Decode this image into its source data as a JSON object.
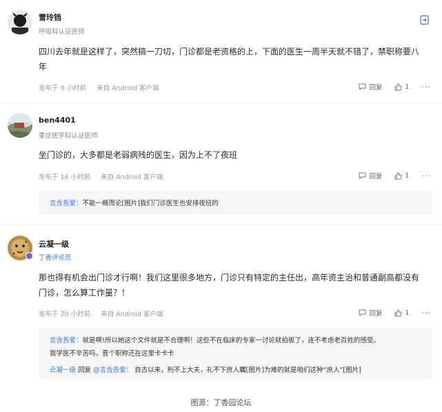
{
  "comments": [
    {
      "username": "雪玲铛",
      "role": "呼吸科认证医师",
      "content_line1": "四川去年就是这样了，突然搞一刀切，门诊都是老资格的上，下面的医生一周半天就不错了，禁职称要八",
      "content_line2": "年",
      "posted": "发布于 9 小时前",
      "source": "来自 Android 客户端",
      "reply_label": "回复",
      "likes": "1"
    },
    {
      "username": "ben4401",
      "role": "重症医学科认证医师",
      "content_line1": "坐门诊的，大多都是老弱病残的医生，因为上不了夜班",
      "posted": "发布于 16 小时前",
      "source": "来自 Android 客户端",
      "reply_label": "回复",
      "likes": "1",
      "replies": [
        {
          "author": "言含吾爱：",
          "text": "不能一概而论[图片]我们门诊医生也安排夜班的"
        }
      ]
    },
    {
      "username": "云凝一级",
      "role": "丁香评论员",
      "content_line1": "那也得有机会出门诊才行啊！我们这里很多地方，门诊只有特定的主任出，高年资主治和普通副高都没有",
      "content_line2": "门诊，怎么算工作量？！",
      "posted": "发布于 20 小时前",
      "source": "来自 Android 客户端",
      "reply_label": "回复",
      "likes": "1",
      "replies": [
        {
          "author": "言含吾爱：",
          "text": "就是啊!所以她这个文件就是不合理啊！这些不在临床的专家一讨论就拍板了，连不考虑老百姓的感受。",
          "text2": "我学医不辛苦吗，晋个职称还在这里卡卡卡"
        },
        {
          "author": "云凝一级",
          "mid": "回复",
          "target": "@言含吾爱：",
          "text": "自古以来，刑不上大夫，礼不下庶人瞩[图片]为难的就是咱们这种“庶人”[图片]"
        }
      ]
    }
  ],
  "footer": "图源：丁香园论坛",
  "more_label": "···"
}
